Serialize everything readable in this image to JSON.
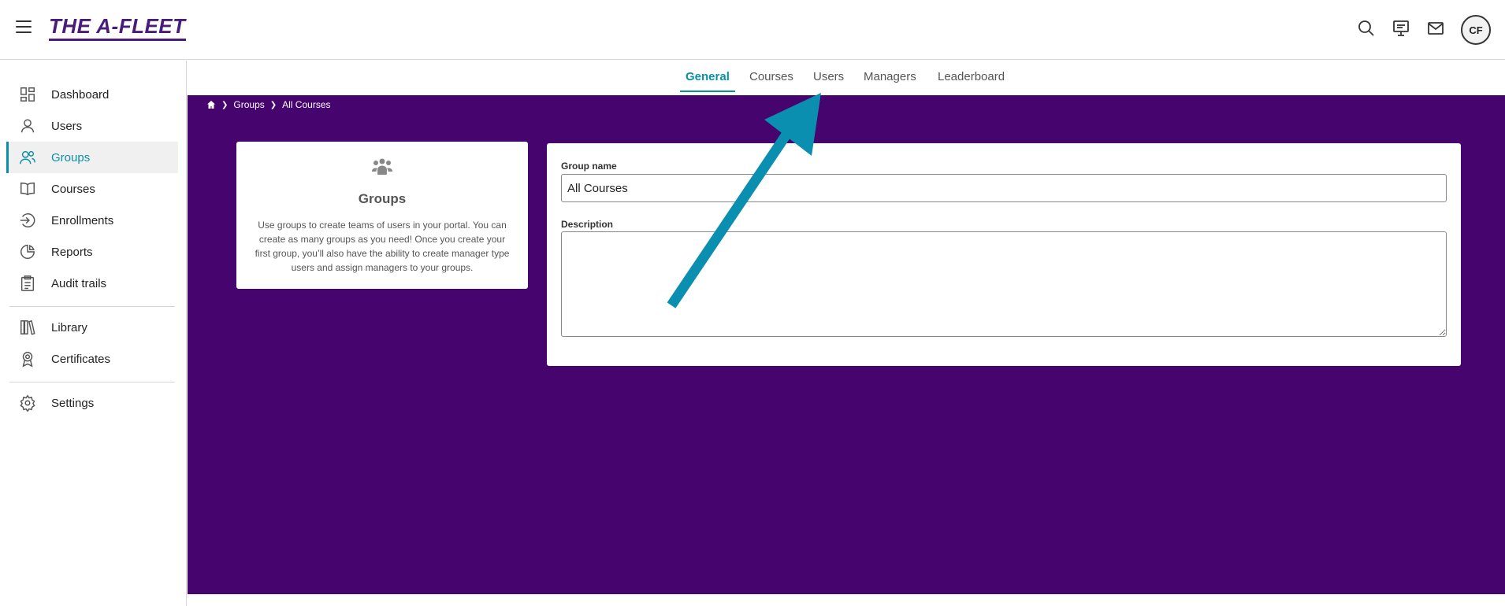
{
  "header": {
    "logo_text": "THE A-FLEET",
    "avatar_initials": "CF",
    "icons": [
      "menu-icon",
      "search-icon",
      "presentation-icon",
      "mail-icon"
    ]
  },
  "sidebar": {
    "items": [
      {
        "label": "Dashboard",
        "icon": "dashboard-icon"
      },
      {
        "label": "Users",
        "icon": "user-icon"
      },
      {
        "label": "Groups",
        "icon": "groups-icon",
        "active": true
      },
      {
        "label": "Courses",
        "icon": "book-icon"
      },
      {
        "label": "Enrollments",
        "icon": "enroll-icon"
      },
      {
        "label": "Reports",
        "icon": "pie-chart-icon"
      },
      {
        "label": "Audit trails",
        "icon": "clipboard-icon"
      },
      {
        "label": "Library",
        "icon": "library-icon"
      },
      {
        "label": "Certificates",
        "icon": "certificate-icon"
      },
      {
        "label": "Settings",
        "icon": "gear-icon"
      }
    ]
  },
  "tabs": [
    {
      "label": "General",
      "active": true
    },
    {
      "label": "Courses"
    },
    {
      "label": "Users"
    },
    {
      "label": "Managers"
    },
    {
      "label": "Leaderboard"
    }
  ],
  "breadcrumb": {
    "items": [
      "Groups",
      "All Courses"
    ]
  },
  "info_card": {
    "title": "Groups",
    "description": "Use groups to create teams of users in your portal. You can create as many groups as you need! Once you create your first group, you’ll also have the ability to create manager type users and assign managers to your groups."
  },
  "form": {
    "group_name_label": "Group name",
    "group_name_value": "All Courses",
    "description_label": "Description",
    "description_value": ""
  },
  "colors": {
    "brand": "#4a1c7a",
    "accent": "#0a8fa8",
    "main_bg": "#46046e",
    "annotation_arrow": "#0a8fb0"
  }
}
